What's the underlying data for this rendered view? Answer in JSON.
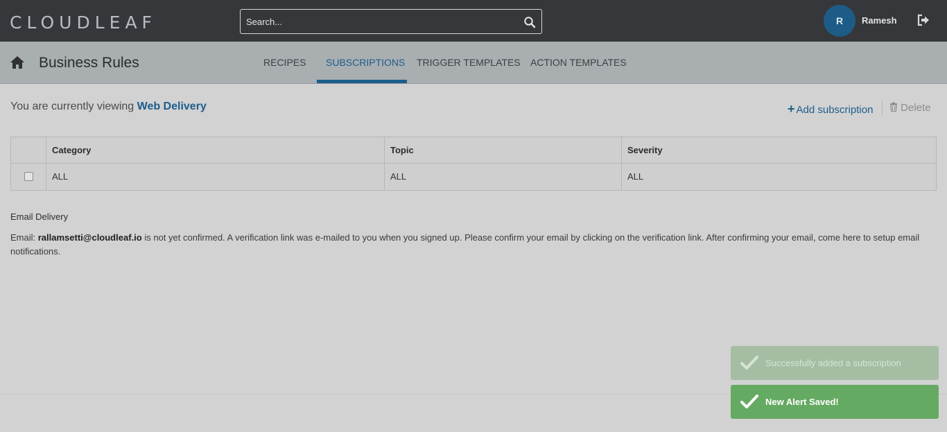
{
  "brand": {
    "logo": "CLOUDLEAF"
  },
  "search": {
    "placeholder": "Search..."
  },
  "user": {
    "initial": "R",
    "name": "Ramesh"
  },
  "header": {
    "title": "Business Rules",
    "tabs": [
      {
        "label": "RECIPES",
        "active": false
      },
      {
        "label": "SUBSCRIPTIONS",
        "active": true
      },
      {
        "label": "TRIGGER TEMPLATES",
        "active": false
      },
      {
        "label": "ACTION TEMPLATES",
        "active": false
      }
    ]
  },
  "viewing": {
    "prefix": "You are currently viewing",
    "name": "Web Delivery"
  },
  "actions": {
    "add_label": "Add subscription",
    "delete_label": "Delete"
  },
  "table": {
    "columns": [
      "Category",
      "Topic",
      "Severity"
    ],
    "rows": [
      {
        "category": "ALL",
        "topic": "ALL",
        "severity": "ALL"
      }
    ]
  },
  "email": {
    "title": "Email Delivery",
    "label": "Email:",
    "address": "rallamsetti@cloudleaf.io",
    "message": "is not yet confirmed. A verification link was e-mailed to you when you signed up. Please confirm your email by clicking on the verification link. After confirming your email, come here to setup email notifications."
  },
  "toasts": [
    {
      "message": "Successfully added a subscription"
    },
    {
      "message": "New Alert Saved!"
    }
  ],
  "colors": {
    "accent": "#1c5d8c",
    "topbar": "#35373b",
    "success": "#65aa62"
  }
}
